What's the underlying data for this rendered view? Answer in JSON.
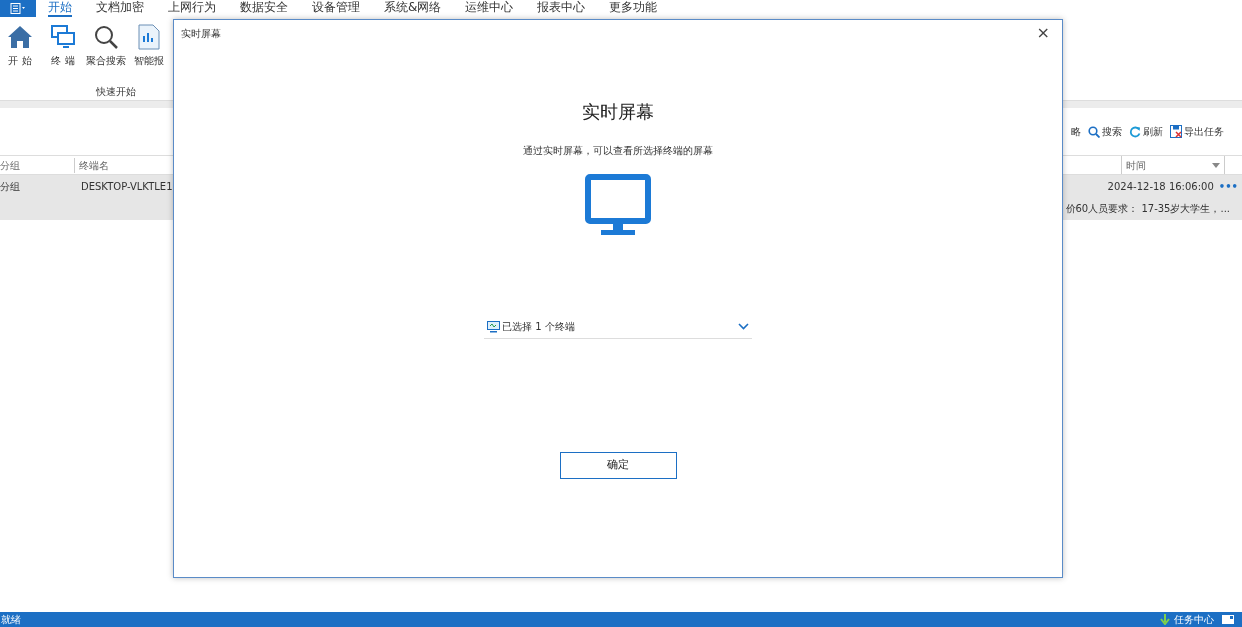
{
  "menu_tabs": [
    {
      "label": "开始",
      "selected": true
    },
    {
      "label": "文档加密",
      "selected": false
    },
    {
      "label": "上网行为",
      "selected": false
    },
    {
      "label": "数据安全",
      "selected": false
    },
    {
      "label": "设备管理",
      "selected": false
    },
    {
      "label": "系统&网络",
      "selected": false
    },
    {
      "label": "运维中心",
      "selected": false
    },
    {
      "label": "报表中心",
      "selected": false
    },
    {
      "label": "更多功能",
      "selected": false
    }
  ],
  "ribbon": {
    "buttons": [
      {
        "kind": "home",
        "label": "开 始"
      },
      {
        "kind": "terminal",
        "label": "终 端"
      },
      {
        "kind": "search",
        "label": "聚合搜索"
      },
      {
        "kind": "report",
        "label": "智能报"
      }
    ],
    "group_label": "快速开始"
  },
  "toolbar": [
    {
      "kind": "partial",
      "label": "略"
    },
    {
      "kind": "search",
      "label": "搜索"
    },
    {
      "kind": "refresh",
      "label": "刷新"
    },
    {
      "kind": "export",
      "label": "导出任务"
    }
  ],
  "table": {
    "columns": [
      "分组",
      "终端名",
      "时间"
    ],
    "rows": [
      {
        "selected": true,
        "group": "分组",
        "terminal": "DESKTOP-VLKTLE1",
        "time": "2024-12-18 16:06:00",
        "more": "•••",
        "detail": "价60人员要求： 17-35岁大学生，..."
      }
    ]
  },
  "dialog": {
    "title": "实时屏幕",
    "close": "×",
    "heading": "实时屏幕",
    "description": "通过实时屏幕，可以查看所选择终端的屏幕",
    "selector": "已选择 1 个终端",
    "confirm": "确定"
  },
  "status_bar": {
    "left": "就绪",
    "right": "任务中心"
  }
}
